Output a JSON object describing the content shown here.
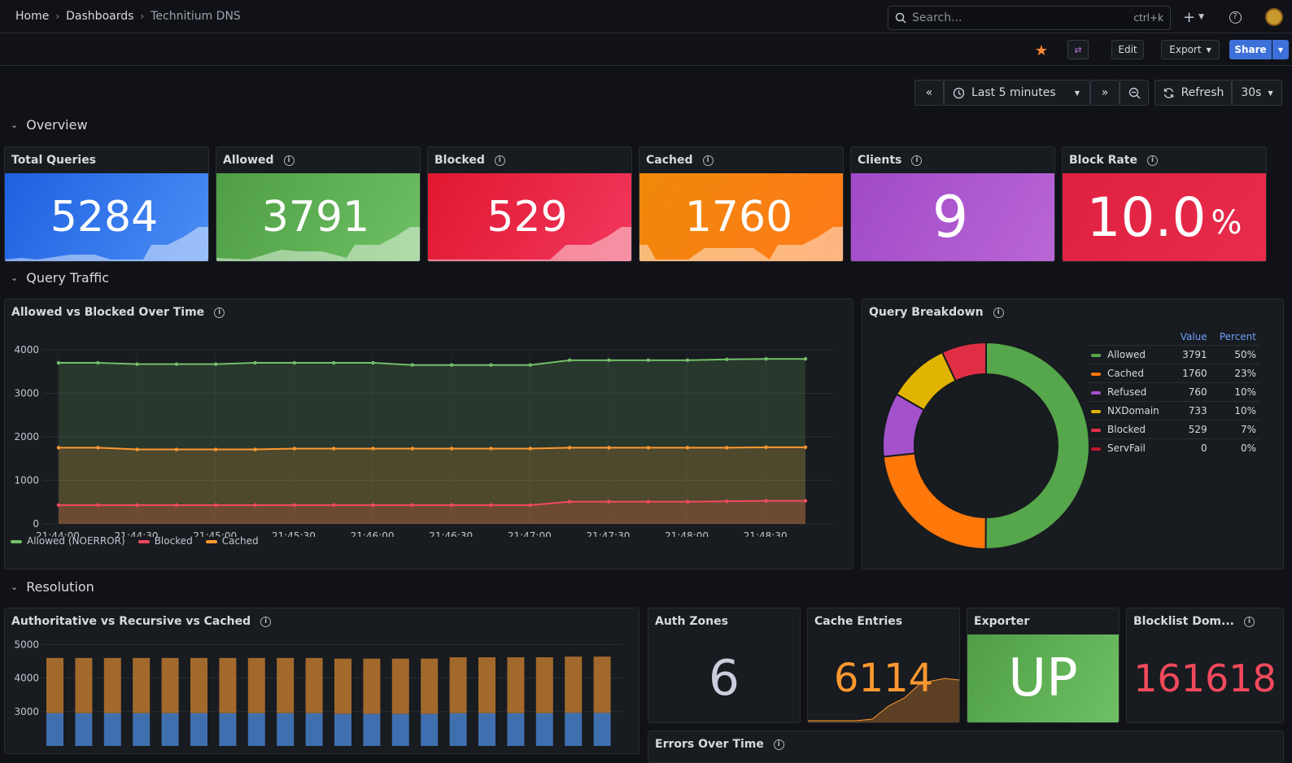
{
  "breadcrumb": {
    "home": "Home",
    "dashboards": "Dashboards",
    "current": "Technitium DNS"
  },
  "search": {
    "placeholder": "Search...",
    "shortcut": "ctrl+k"
  },
  "toolbar": {
    "edit": "Edit",
    "export": "Export",
    "share": "Share"
  },
  "time": {
    "range": "Last 5 minutes",
    "refresh": "Refresh",
    "interval": "30s"
  },
  "rows": {
    "overview": "Overview",
    "traffic": "Query Traffic",
    "resolution": "Resolution"
  },
  "stats": [
    {
      "title": "Total Queries",
      "value": "5284",
      "unit": "",
      "color": "#1f60e0",
      "info": false
    },
    {
      "title": "Allowed",
      "value": "3791",
      "unit": "",
      "color": "#56a64b",
      "info": true
    },
    {
      "title": "Blocked",
      "value": "529",
      "unit": "",
      "color": "#e02f44",
      "info": true
    },
    {
      "title": "Cached",
      "value": "1760",
      "unit": "",
      "color": "#ff780a",
      "info": true
    },
    {
      "title": "Clients",
      "value": "9",
      "unit": "",
      "color": "#a352cc",
      "info": true
    },
    {
      "title": "Block Rate",
      "value": "10.0",
      "unit": "%",
      "color": "#e02f44",
      "info": true
    }
  ],
  "traffic_panel": {
    "title": "Allowed vs Blocked Over Time"
  },
  "breakdown_panel": {
    "title": "Query Breakdown",
    "col_value": "Value",
    "col_percent": "Percent"
  },
  "resolution_panel": {
    "title": "Authoritative vs Recursive vs Cached"
  },
  "small_stats": {
    "auth_zones": {
      "title": "Auth Zones",
      "value": "6"
    },
    "cache_entries": {
      "title": "Cache Entries",
      "value": "6114"
    },
    "exporter": {
      "title": "Exporter",
      "value": "UP"
    },
    "blocklist": {
      "title": "Blocklist Dom...",
      "value": "161618"
    }
  },
  "errors_panel": {
    "title": "Errors Over Time"
  },
  "chart_data": [
    {
      "type": "line",
      "title": "Allowed vs Blocked Over Time",
      "x": [
        "21:44:00",
        "21:44:30",
        "21:45:00",
        "21:45:30",
        "21:46:00",
        "21:46:30",
        "21:47:00",
        "21:47:30",
        "21:48:00",
        "21:48:30"
      ],
      "x_points": 20,
      "ylim": [
        0,
        4000
      ],
      "yticks": [
        "0",
        "1000",
        "2000",
        "3000",
        "4000"
      ],
      "series": [
        {
          "name": "Allowed (NOERROR)",
          "color": "#73bf69",
          "values": [
            3700,
            3700,
            3670,
            3670,
            3670,
            3700,
            3700,
            3700,
            3700,
            3650,
            3650,
            3650,
            3650,
            3760,
            3760,
            3760,
            3760,
            3780,
            3790,
            3790
          ]
        },
        {
          "name": "Blocked",
          "color": "#f2495c",
          "values": [
            430,
            430,
            430,
            430,
            430,
            430,
            430,
            430,
            430,
            430,
            430,
            430,
            430,
            510,
            510,
            510,
            510,
            520,
            529,
            529
          ]
        },
        {
          "name": "Cached",
          "color": "#ff9830",
          "values": [
            1750,
            1750,
            1710,
            1710,
            1710,
            1710,
            1730,
            1730,
            1730,
            1730,
            1730,
            1730,
            1730,
            1750,
            1750,
            1750,
            1750,
            1750,
            1760,
            1760
          ]
        }
      ],
      "legend": "bottom"
    },
    {
      "type": "pie",
      "title": "Query Breakdown",
      "slices": [
        {
          "name": "Allowed",
          "value": 3791,
          "percent": "50%",
          "color": "#56a64b"
        },
        {
          "name": "Cached",
          "value": 1760,
          "percent": "23%",
          "color": "#ff780a"
        },
        {
          "name": "Refused",
          "value": 760,
          "percent": "10%",
          "color": "#a352cc"
        },
        {
          "name": "NXDomain",
          "value": 733,
          "percent": "10%",
          "color": "#e0b400"
        },
        {
          "name": "Blocked",
          "value": 529,
          "percent": "7%",
          "color": "#e02f44"
        },
        {
          "name": "ServFail",
          "value": 0,
          "percent": "0%",
          "color": "#c4162a"
        }
      ]
    },
    {
      "type": "bar",
      "title": "Authoritative vs Recursive vs Cached",
      "yticks": [
        "3000",
        "4000",
        "5000"
      ],
      "ylim": [
        2000,
        5300
      ],
      "stack_total": [
        4600,
        4600,
        4600,
        4600,
        4600,
        4600,
        4600,
        4600,
        4600,
        4600,
        4580,
        4580,
        4580,
        4580,
        4620,
        4620,
        4620,
        4620,
        4640,
        4640
      ],
      "lower": [
        2950,
        2950,
        2950,
        2950,
        2950,
        2950,
        2950,
        2950,
        2950,
        2950,
        2930,
        2930,
        2930,
        2930,
        2950,
        2950,
        2950,
        2950,
        2960,
        2960
      ]
    }
  ]
}
